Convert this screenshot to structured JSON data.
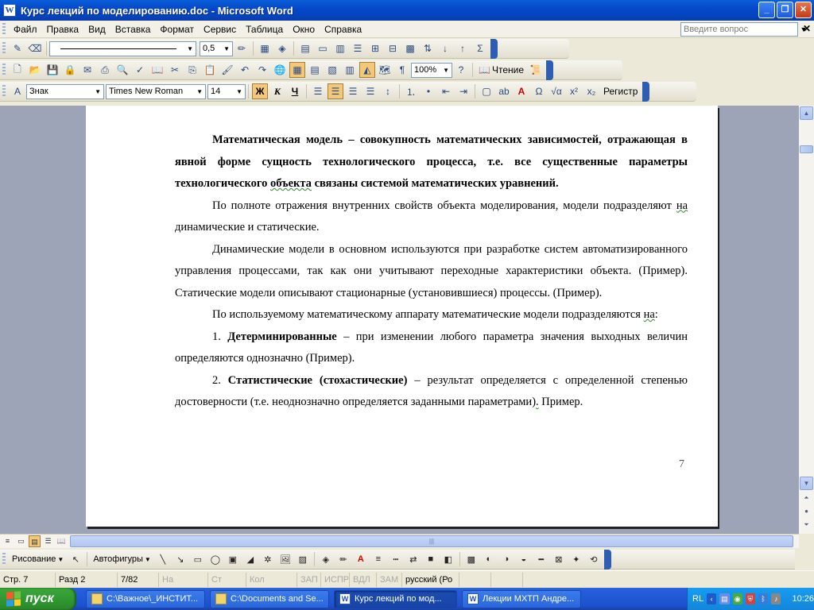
{
  "window": {
    "title": "Курс лекций по моделированию.doc - Microsoft Word",
    "app_icon": "W",
    "btn_min": "_",
    "btn_max": "❐",
    "btn_close": "✕"
  },
  "menu": {
    "items": [
      "Файл",
      "Правка",
      "Вид",
      "Вставка",
      "Формат",
      "Сервис",
      "Таблица",
      "Окно",
      "Справка"
    ],
    "help_placeholder": "Введите вопрос",
    "close_doc": "✕"
  },
  "toolbar1": {
    "line_width": "0,5"
  },
  "toolbar2": {
    "zoom": "100%",
    "read_label": "Чтение"
  },
  "toolbar3": {
    "style": "Знак",
    "font": "Times New Roman",
    "size": "14",
    "bold": "Ж",
    "italic": "К",
    "underline": "Ч",
    "register_label": "Регистр"
  },
  "document": {
    "p1": "Математическая модель – совокупность математических зависимостей, отражающая в явной форме сущность технологического процесса, т.е. все существенные параметры технологического",
    "p1_squig": "объекта",
    "p1_end": "связаны системой математических уравнений.",
    "p2_a": "По полноте отражения внутренних свойств объекта моделирования, модели подразделяют",
    "p2_squig": "на",
    "p2_b": "динамические и статические.",
    "p3": "Динамические модели в основном используются при разработке систем автоматизированного управления процессами, так как они учитывают переходные характеристики объекта. (Пример). Статические модели описывают стационарные (установившиеся) процессы. (Пример).",
    "p4_a": "По используемому математическому аппарату математические модели подразделяются",
    "p4_squig": "на",
    "p4_b": ":",
    "p5_num": "1.",
    "p5_bold": "Детерминированные",
    "p5_rest": "– при изменении любого параметра значения выходных величин определяются однозначно (Пример).",
    "p6_num": "2.",
    "p6_bold": "Статистические (стохастические)",
    "p6_rest": "– результат определяется с определенной степенью достоверности (т.е. неоднозначно определяется заданными параметрами)",
    "p6_end": "Пример.",
    "page_number": "7"
  },
  "drawing": {
    "draw_label": "Рисование",
    "autoshapes_label": "Автофигуры"
  },
  "status": {
    "page": "Стр. 7",
    "section": "Разд 2",
    "pages": "7/82",
    "at": "На",
    "line": "Ст",
    "col": "Кол",
    "rec": "ЗАП",
    "trk": "ИСПР",
    "ext": "ВДЛ",
    "ovr": "ЗАМ",
    "lang": "русский (Ро"
  },
  "taskbar": {
    "start": "пуск",
    "tasks": [
      "C:\\Важное\\_ИНСТИТ...",
      "C:\\Documents and Se...",
      "Курс лекций по мод...",
      "Лекции МХТП Андре..."
    ],
    "lang": "RL",
    "clock": "10:26"
  }
}
